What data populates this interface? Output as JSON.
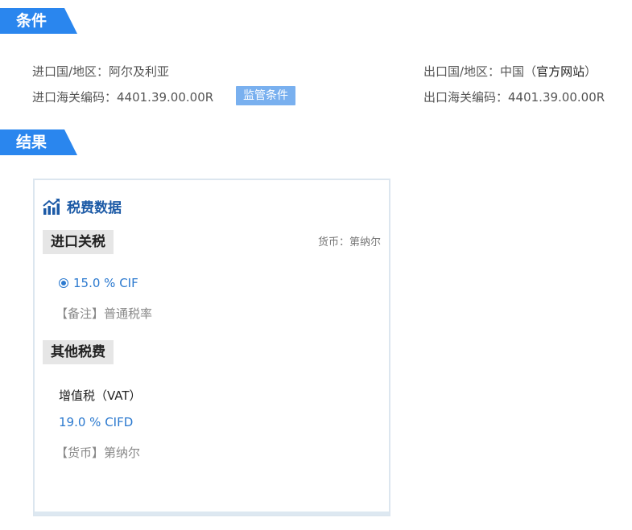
{
  "sections": {
    "conditions": "条件",
    "results": "结果"
  },
  "conditions": {
    "import_country": "进口国/地区：阿尔及利亚",
    "import_code": "进口海关编码：4401.39.00.00R",
    "supervise_button": "监管条件",
    "export_country_prefix": "出口国/地区：中国（",
    "export_country_link": "官方网站",
    "export_country_suffix": "）",
    "export_code": "出口海关编码：4401.39.00.00R"
  },
  "card": {
    "title": "税费数据",
    "title_icon": "chart-growth-icon",
    "import_duty": {
      "header": "进口关税",
      "currency": "货币：第纳尔",
      "rate": "15.0 % CIF",
      "note": "【备注】普通税率"
    },
    "other_taxes": {
      "header": "其他税费",
      "vat_name": "增值税（VAT）",
      "vat_rate": "19.0 % CIFD",
      "vat_currency": "【货币】第纳尔"
    }
  },
  "colors": {
    "accent": "#2a86ee",
    "button": "#79b0ef",
    "title_blue": "#1c5aa6",
    "value_blue": "#2b79cf"
  }
}
